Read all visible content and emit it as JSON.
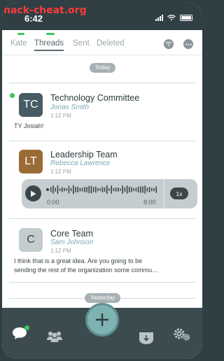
{
  "watermark": "hack-cheat.org",
  "status": {
    "time": "6:42"
  },
  "tabs": [
    {
      "label": "Kate",
      "active": false
    },
    {
      "label": "Threads",
      "active": true
    },
    {
      "label": "Sent",
      "active": false
    },
    {
      "label": "Deleted",
      "active": false
    }
  ],
  "header_icons": [
    "filter-icon",
    "more-icon"
  ],
  "days": {
    "today": "Today",
    "yesterday": "Yesterday"
  },
  "threads": [
    {
      "initials": "TC",
      "title": "Technology Committee",
      "author": "Jonas Smith",
      "time": "1:12 PM",
      "preview": "TY Josiah!",
      "avatar_color": "#475b64",
      "unread": true
    },
    {
      "initials": "LT",
      "title": "Leadership Team",
      "author": "Rebecca Lawrence",
      "time": "1:12 PM",
      "avatar_color": "#9a6c35",
      "audio": {
        "start": "0:00",
        "end": "8:00",
        "speed": "1x"
      }
    },
    {
      "initials": "C",
      "title": "Core Team",
      "author": "Sam Johnson",
      "time": "1:12 PM",
      "preview_line1": "I think that is a great idea. Are you going to be",
      "preview_line2": "sending the rest of the organization some commu…",
      "avatar_color": "#c4ccd0"
    }
  ],
  "bottom_nav": [
    "chat-icon",
    "people-icon",
    "compose-icon",
    "inbox-icon",
    "settings-icon"
  ],
  "colors": {
    "accent_green": "#3ec45a",
    "nav_bg": "#3b4b50",
    "fab": "#7fb3b1"
  }
}
